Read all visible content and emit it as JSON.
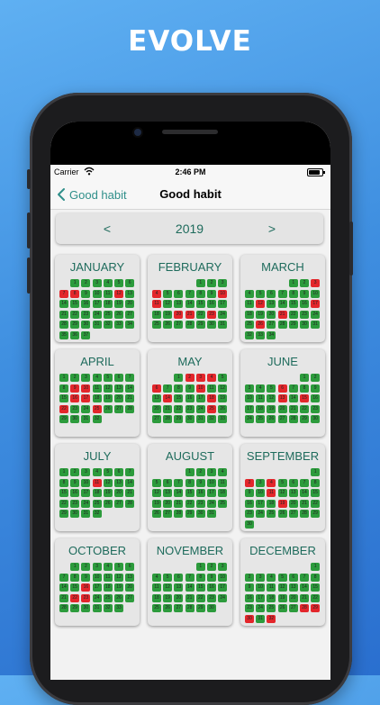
{
  "promo": {
    "title": "EVOLVE"
  },
  "statusbar": {
    "carrier": "Carrier",
    "time": "2:46 PM"
  },
  "navbar": {
    "back_label": "Good habit",
    "title": "Good habit"
  },
  "year_nav": {
    "prev": "<",
    "year": "2019",
    "next": ">"
  },
  "colors": {
    "done": "#2c9b3c",
    "missed": "#e3262b",
    "accent": "#1e6b5c"
  },
  "months": [
    {
      "name": "JANUARY",
      "offset": 1,
      "days": "ggggggrrgggrggggggggggggggggggggggggg"
    },
    {
      "name": "FEBRUARY",
      "offset": 4,
      "days": "gggrgggggrrggggggggrrgrgggggggg"
    },
    {
      "name": "MARCH",
      "offset": 4,
      "days": "ggrggggggggrggggrgggrggggrgggggggg"
    },
    {
      "name": "APRIL",
      "offset": 0,
      "days": "ggggggggrrgggggrrggggrggrggggggg"
    },
    {
      "name": "MAY",
      "offset": 2,
      "days": "grrrgrgggrgggrgggrggggggrgggggggg"
    },
    {
      "name": "JUNE",
      "offset": 5,
      "days": "gggggrggggggrgrggggggggggggggg"
    },
    {
      "name": "JULY",
      "offset": 0,
      "days": "ggggggggggrggggggggggggggggggggg"
    },
    {
      "name": "AUGUST",
      "offset": 3,
      "days": "ggggggggggggggggggggggggggggggg"
    },
    {
      "name": "SEPTEMBER",
      "offset": 6,
      "days": "grgrggggggrgggggggrggggggggggg"
    },
    {
      "name": "OCTOBER",
      "offset": 1,
      "days": "gggggggggggggggrgggggrrgggggggggg"
    },
    {
      "name": "NOVEMBER",
      "offset": 4,
      "days": "gggggggggggggggggggggggggggggg"
    },
    {
      "name": "DECEMBER",
      "offset": 6,
      "days": "gggggggggggggggggggggggggggrrrgr"
    }
  ]
}
